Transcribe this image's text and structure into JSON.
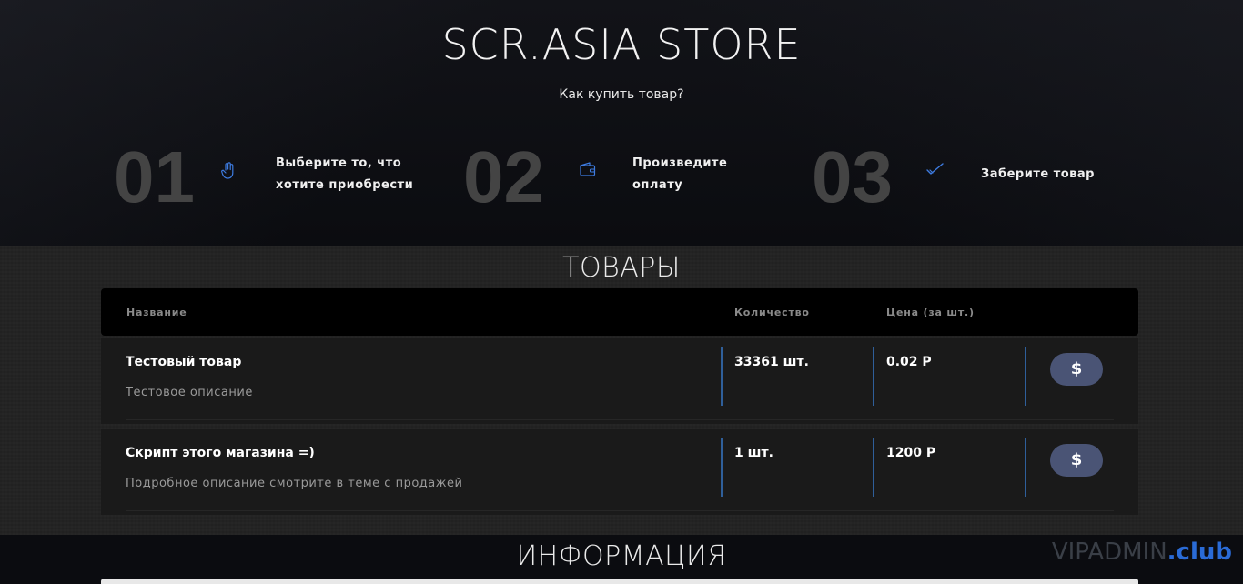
{
  "header": {
    "brand": "SCR.ASIA STORE",
    "how_to_buy": "Как купить товар?"
  },
  "steps": [
    {
      "num": "01",
      "icon": "hand-pointer-icon",
      "text_line1": "Выберите то, что",
      "text_line2": "хотите приобрести"
    },
    {
      "num": "02",
      "icon": "wallet-icon",
      "text_line1": "Произведите",
      "text_line2": "оплату"
    },
    {
      "num": "03",
      "icon": "check-icon",
      "text_line1": "Заберите товар",
      "text_line2": ""
    }
  ],
  "products": {
    "title": "ТОВАРЫ",
    "columns": {
      "name": "Название",
      "qty": "Количество",
      "price": "Цена (за шт.)"
    },
    "rows": [
      {
        "name": "Тестовый товар",
        "description": "Тестовое описание",
        "qty": "33361 шт.",
        "price": "0.02 Р",
        "buy_label": "$"
      },
      {
        "name": "Скрипт этого магазина =)",
        "description": "Подробное описание смотрите в теме с продажей",
        "qty": "1 шт.",
        "price": "1200 Р",
        "buy_label": "$"
      }
    ]
  },
  "info": {
    "title": "ИНФОРМАЦИЯ"
  },
  "watermark": {
    "main": "VIPADMIN",
    "tld": ".club"
  },
  "colors": {
    "accent_blue": "#2a6bd6",
    "buy_button": "#4a5475",
    "step_number": "#444444"
  }
}
